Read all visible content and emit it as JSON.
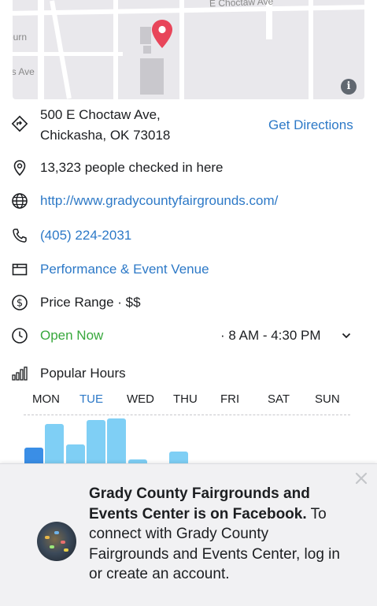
{
  "map": {
    "street_top": "E Choctaw Ave",
    "street_left_top": "ourn",
    "street_left_mid": "is Ave",
    "info_label": "i",
    "pin_color": "#e8455a"
  },
  "address": {
    "line1": "500 E Choctaw Ave,",
    "line2": "Chickasha, OK 73018",
    "directions_label": "Get Directions"
  },
  "checkins": "13,323 people checked in here",
  "website": "http://www.gradycountyfairgrounds.com/",
  "phone": "(405) 224-2031",
  "category": "Performance & Event Venue",
  "price": "Price Range · $$",
  "hours": {
    "status": "Open Now",
    "range": "· 8 AM - 4:30 PM",
    "status_color": "#38a83d"
  },
  "popular_hours": {
    "title": "Popular Hours",
    "days": [
      "MON",
      "TUE",
      "WED",
      "THU",
      "FRI",
      "SAT",
      "SUN"
    ],
    "selected_day": "TUE"
  },
  "chart_data": {
    "type": "bar",
    "categories": [
      "",
      "",
      "",
      "",
      "",
      "",
      "",
      "",
      ""
    ],
    "values": [
      0.34,
      0.86,
      0.42,
      0.95,
      0.99,
      0.08,
      0,
      0.25,
      0
    ],
    "highlight_index": 0,
    "colors": {
      "bar": "#7fcff5",
      "current": "#3a8ee6"
    }
  },
  "login_prompt": {
    "bold": "Grady County Fairgrounds and Events Center is on Facebook.",
    "text": " To connect with Grady County Fairgrounds and Events Center, log in or create an account."
  }
}
